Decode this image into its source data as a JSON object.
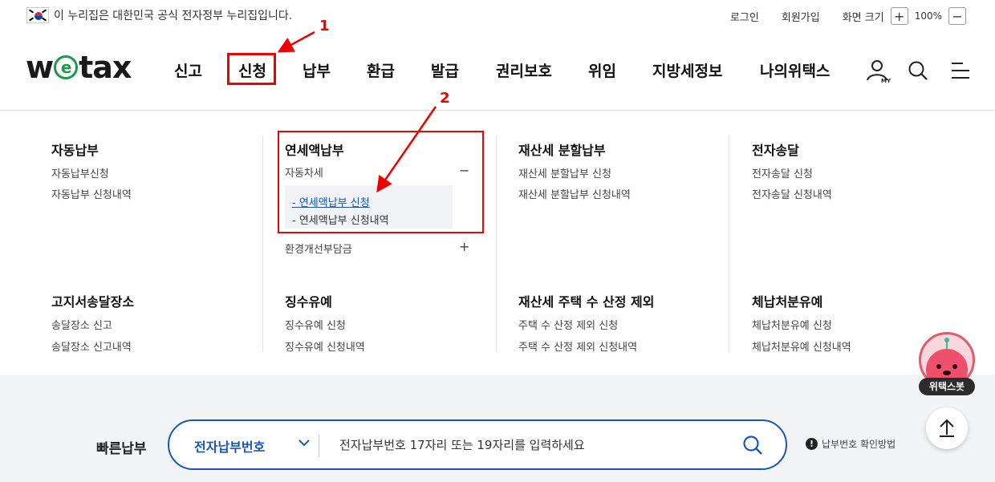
{
  "gov_banner": {
    "text": "이 누리집은 대한민국 공식 전자정부 누리집입니다.",
    "login": "로그인",
    "signup": "회원가입",
    "screen_size": "화면 크기",
    "zoom_in": "+",
    "zoom_value": "100%",
    "zoom_out": "−"
  },
  "logo": {
    "pre": "w",
    "mid": "e",
    "post": "tax"
  },
  "nav": {
    "items": [
      "신고",
      "신청",
      "납부",
      "환급",
      "발급",
      "권리보호",
      "위임",
      "지방세정보",
      "나의위택스"
    ],
    "my_label": "MY"
  },
  "annotations": {
    "one": "1",
    "two": "2"
  },
  "mega_menu": {
    "auto_payment": {
      "title": "자동납부",
      "items": [
        "자동납부신청",
        "자동납부 신청내역"
      ]
    },
    "annual_payment": {
      "title": "연세액납부",
      "car_tax": "자동차세",
      "car_tax_toggle": "−",
      "sub_items": [
        "연세액납부 신청",
        "연세액납부 신청내역"
      ],
      "env_charge": "환경개선부담금",
      "env_toggle": "+"
    },
    "property_installment": {
      "title": "재산세 분할납부",
      "items": [
        "재산세 분할납부 신청",
        "재산세 분할납부 신청내역"
      ]
    },
    "e_delivery": {
      "title": "전자송달",
      "items": [
        "전자송달 신청",
        "전자송달 신청내역"
      ]
    },
    "notice_address": {
      "title": "고지서송달장소",
      "items": [
        "송달장소 신고",
        "송달장소 신고내역"
      ]
    },
    "collection_deferral": {
      "title": "징수유예",
      "items": [
        "징수유예 신청",
        "징수유예 신청내역"
      ]
    },
    "property_house_exclusion": {
      "title": "재산세 주택 수 산정 제외",
      "items": [
        "주택 수 산정 제외 신청",
        "주택 수 산정 제외 신청내역"
      ]
    },
    "arrears_deferral": {
      "title": "체납처분유예",
      "items": [
        "체납처분유예 신청",
        "체납처분유예 신청내역"
      ]
    }
  },
  "quick_pay": {
    "label": "빠른납부",
    "type": "전자납부번호",
    "placeholder": "전자납부번호 17자리 또는 19자리를 입력하세요",
    "help_mark": "!",
    "help": "납부번호 확인방법"
  },
  "chatbot": {
    "label": "위택스봇"
  },
  "colors": {
    "primary": "#1a56b8",
    "annotation": "#e00000",
    "logo_green": "#1c9a4c"
  }
}
